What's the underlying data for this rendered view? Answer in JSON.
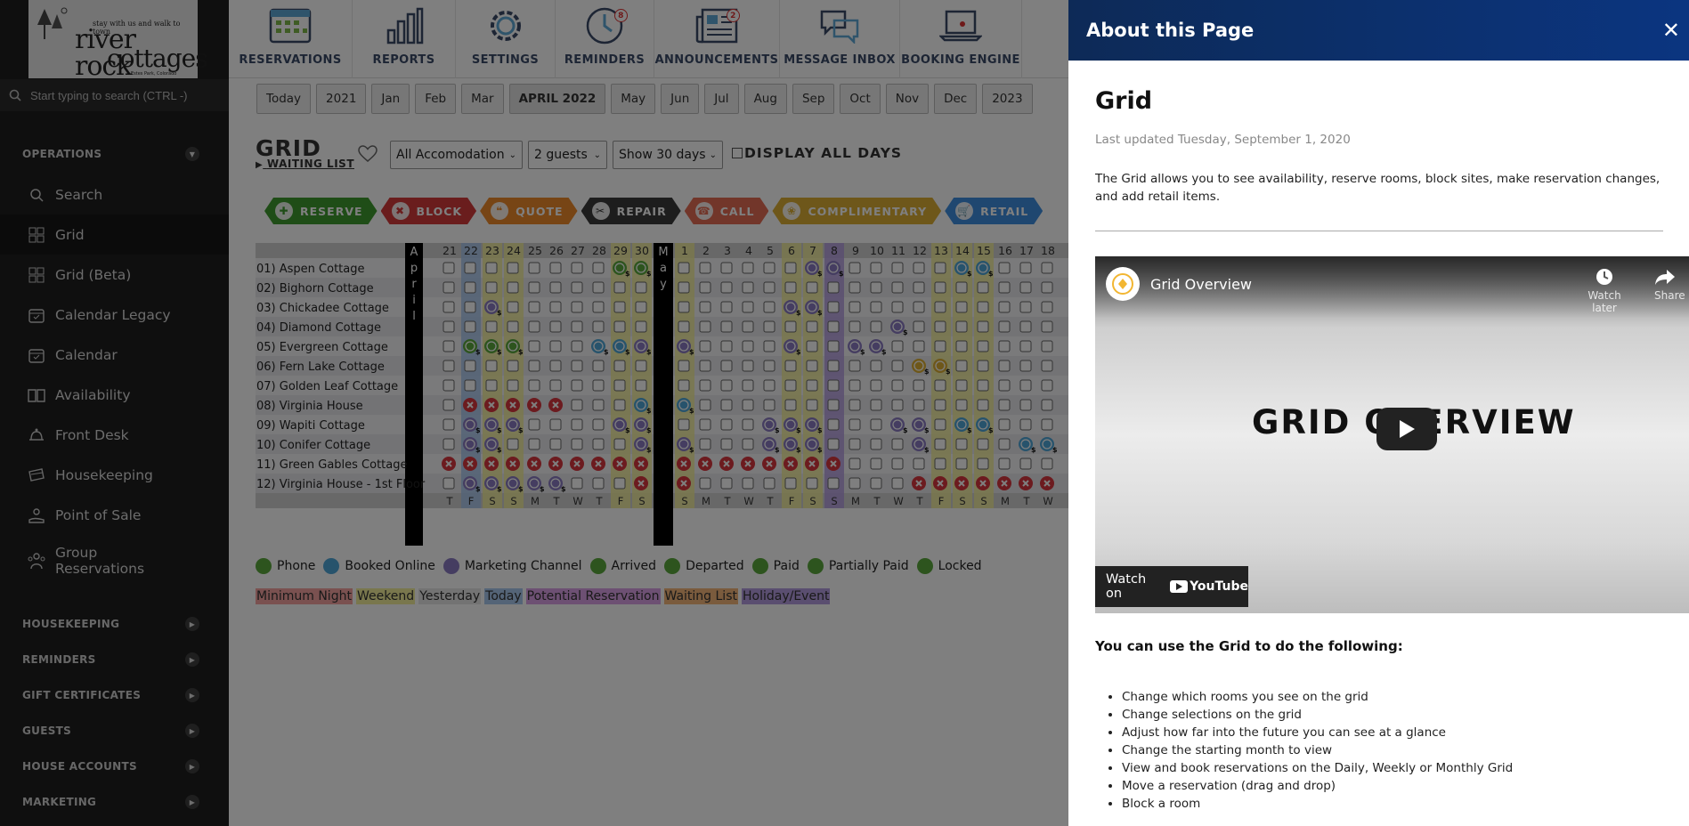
{
  "logo": {
    "tagline": "stay with us and walk to town",
    "line1": "river rock",
    "line2": "cottages",
    "location": "Estes Park, Colorado"
  },
  "search": {
    "placeholder": "Start typing to search (CTRL -)"
  },
  "sidebar": {
    "operations_header": "OPERATIONS",
    "items": [
      {
        "label": "Search",
        "icon": "search-icon"
      },
      {
        "label": "Grid",
        "icon": "grid-icon"
      },
      {
        "label": "Grid (Beta)",
        "icon": "grid-icon"
      },
      {
        "label": "Calendar Legacy",
        "icon": "calendar-icon"
      },
      {
        "label": "Calendar",
        "icon": "calendar-icon"
      },
      {
        "label": "Availability",
        "icon": "book-icon"
      },
      {
        "label": "Front Desk",
        "icon": "bell-icon"
      },
      {
        "label": "Housekeeping",
        "icon": "bed-icon"
      },
      {
        "label": "Point of Sale",
        "icon": "hand-icon"
      },
      {
        "label": "Group\nReservations",
        "icon": "group-icon"
      }
    ],
    "sections": [
      "HOUSEKEEPING",
      "REMINDERS",
      "GIFT CERTIFICATES",
      "GUESTS",
      "HOUSE ACCOUNTS",
      "MARKETING"
    ]
  },
  "topnav": [
    {
      "label": "RESERVATIONS",
      "icon": "reservations-icon",
      "badge": ""
    },
    {
      "label": "REPORTS",
      "icon": "bar-chart-icon",
      "badge": ""
    },
    {
      "label": "SETTINGS",
      "icon": "gear-icon",
      "badge": ""
    },
    {
      "label": "REMINDERS",
      "icon": "clock-icon",
      "badge": "8"
    },
    {
      "label": "ANNOUNCEMENTS",
      "icon": "newspaper-icon",
      "badge": "2"
    },
    {
      "label": "MESSAGE INBOX",
      "icon": "chat-icon",
      "badge": ""
    },
    {
      "label": "BOOKING ENGINE",
      "icon": "laptop-icon",
      "badge": ""
    }
  ],
  "months": [
    "Today",
    "2021",
    "Jan",
    "Feb",
    "Mar",
    "APRIL 2022",
    "May",
    "Jun",
    "Jul",
    "Aug",
    "Sep",
    "Oct",
    "Nov",
    "Dec",
    "2023"
  ],
  "current_month": "APRIL 2022",
  "page": {
    "title": "GRID",
    "waiting_list": "WAITING LIST",
    "accommodation": "All Accomodation",
    "guests": "2 guests",
    "days": "Show 30 days",
    "display_all": "DISPLAY ALL DAYS"
  },
  "actions": [
    {
      "label": "RESERVE",
      "color": "#3f9a2e",
      "icon": "plus-icon"
    },
    {
      "label": "BLOCK",
      "color": "#d43a3a",
      "icon": "x-icon"
    },
    {
      "label": "QUOTE",
      "color": "#ee8a2a",
      "icon": "quote-icon"
    },
    {
      "label": "REPAIR",
      "color": "#3a3a3a",
      "icon": "tools-icon"
    },
    {
      "label": "CALL",
      "color": "#e46d55",
      "icon": "phone-icon"
    },
    {
      "label": "COMPLIMENTARY",
      "color": "#dcae34",
      "icon": "gift-icon"
    },
    {
      "label": "RETAIL",
      "color": "#3f8fe0",
      "icon": "cart-icon"
    }
  ],
  "grid": {
    "month_labels": [
      "April",
      "May"
    ],
    "april_dates": [
      "21",
      "22",
      "23",
      "24",
      "25",
      "26",
      "27",
      "28",
      "29",
      "30"
    ],
    "may_dates": [
      "1",
      "2",
      "3",
      "4",
      "5",
      "6",
      "7",
      "8",
      "9",
      "10",
      "11",
      "12",
      "13",
      "14",
      "15",
      "16",
      "17",
      "18"
    ],
    "april_days": [
      "T",
      "F",
      "S",
      "S",
      "M",
      "T",
      "W",
      "T",
      "F",
      "S"
    ],
    "may_days": [
      "S",
      "M",
      "T",
      "W",
      "T",
      "F",
      "S",
      "S",
      "M",
      "T",
      "W",
      "T",
      "F",
      "S",
      "S",
      "M",
      "T",
      "W"
    ],
    "rooms": [
      "01) Aspen Cottage",
      "02) Bighorn Cottage",
      "03) Chickadee Cottage",
      "04) Diamond Cottage",
      "05) Evergreen Cottage",
      "06) Fern Lake Cottage",
      "07) Golden Leaf Cottage",
      "08) Virginia House",
      "09) Wapiti Cottage",
      "10) Conifer Cottage",
      "11) Green Gables Cottage",
      "12) Virginia House - 1st Floor"
    ],
    "cells": [
      "........PP|......MM.....BB...",
      "..........|..................",
      "..M.......|.....MM...........",
      "..........|..........M.......",
      ".PPP...BBM|M....M..MM........",
      "..........|...........CC.....",
      "..........|..................",
      ".XXXXX...B|B.................",
      ".MMM....MM|....MMM...MM.BB...",
      ".MM......M|M...MMM....M....BB",
      "XXXXXXXXXX|XXXXXXXX..........",
      ".MMMMM...X|X..........XXXXXXX"
    ],
    "icon_codes": {
      "P": "phone",
      "B": "booked-online",
      "M": "marketing-channel",
      "X": "blocked",
      "C": "complimentary"
    }
  },
  "legend": [
    {
      "label": "Phone",
      "color": "#5aa83c"
    },
    {
      "label": "Booked Online",
      "color": "#4ea6d8"
    },
    {
      "label": "Marketing Channel",
      "color": "#8a7bc2"
    },
    {
      "label": "Arrived",
      "color": "#5aa83c"
    },
    {
      "label": "Departed",
      "color": "#5aa83c"
    },
    {
      "label": "Paid",
      "color": "#5aa83c"
    },
    {
      "label": "Partially Paid",
      "color": "#5aa83c"
    },
    {
      "label": "Locked",
      "color": "#5aa83c"
    }
  ],
  "legend2": [
    {
      "label": "Minimum Night",
      "color": "#f4a3a0"
    },
    {
      "label": "Weekend",
      "color": "#f3ef9a"
    },
    {
      "label": "Yesterday",
      "color": "#e6e6e6"
    },
    {
      "label": "Today",
      "color": "#a9c8ef"
    },
    {
      "label": "Potential Reservation",
      "color": "#dba1e6"
    },
    {
      "label": "Waiting List",
      "color": "#f5b77a"
    },
    {
      "label": "Holiday/Event",
      "color": "#b59de0"
    }
  ],
  "panel": {
    "header": "About this Page",
    "close": "✕",
    "title": "Grid",
    "updated": "Last updated Tuesday, September 1, 2020",
    "description": "The Grid allows you to see availability, reserve rooms, block sites, make reservation changes, and add retail items.",
    "video": {
      "title": "Grid Overview",
      "watch_later": "Watch later",
      "share": "Share",
      "overlay_text": "GRID OVERVIEW",
      "watch_on": "Watch on",
      "youtube": "YouTube"
    },
    "subheading": "You can use the Grid to do the following:",
    "bullets": [
      "Change which rooms you see on the grid",
      "Change selections on the grid",
      "Adjust how far into the future you can see at a glance",
      "Change the starting month to view",
      "View and book reservations on the Daily, Weekly or Monthly Grid",
      "Move a reservation (drag and drop)",
      "Block a room"
    ]
  }
}
